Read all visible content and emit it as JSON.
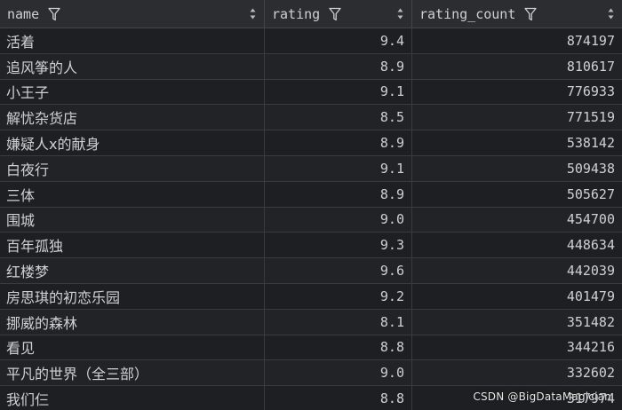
{
  "table": {
    "columns": [
      {
        "label": "name",
        "filter_icon": "filter-icon",
        "sort_icon": "sort-arrows-icon"
      },
      {
        "label": "rating",
        "filter_icon": "filter-icon",
        "sort_icon": "sort-arrows-icon"
      },
      {
        "label": "rating_count",
        "filter_icon": "filter-icon",
        "sort_icon": "sort-arrows-icon"
      }
    ],
    "rows": [
      {
        "name": "活着",
        "rating": "9.4",
        "rating_count": "874197"
      },
      {
        "name": "追风筝的人",
        "rating": "8.9",
        "rating_count": "810617"
      },
      {
        "name": "小王子",
        "rating": "9.1",
        "rating_count": "776933"
      },
      {
        "name": "解忧杂货店",
        "rating": "8.5",
        "rating_count": "771519"
      },
      {
        "name": "嫌疑人x的献身",
        "rating": "8.9",
        "rating_count": "538142"
      },
      {
        "name": "白夜行",
        "rating": "9.1",
        "rating_count": "509438"
      },
      {
        "name": "三体",
        "rating": "8.9",
        "rating_count": "505627"
      },
      {
        "name": "围城",
        "rating": "9.0",
        "rating_count": "454700"
      },
      {
        "name": "百年孤独",
        "rating": "9.3",
        "rating_count": "448634"
      },
      {
        "name": "红楼梦",
        "rating": "9.6",
        "rating_count": "442039"
      },
      {
        "name": "房思琪的初恋乐园",
        "rating": "9.2",
        "rating_count": "401479"
      },
      {
        "name": "挪威的森林",
        "rating": "8.1",
        "rating_count": "351482"
      },
      {
        "name": "看见",
        "rating": "8.8",
        "rating_count": "344216"
      },
      {
        "name": "平凡的世界（全三部）",
        "rating": "9.0",
        "rating_count": "332602"
      },
      {
        "name": "我们仨",
        "rating": "8.8",
        "rating_count": "317974"
      }
    ]
  },
  "watermark": "CSDN @BigDataMagician",
  "colors": {
    "background": "#1e1f22",
    "header_background": "#2b2d30",
    "text": "#cdd1d6",
    "border": "#393b40"
  }
}
